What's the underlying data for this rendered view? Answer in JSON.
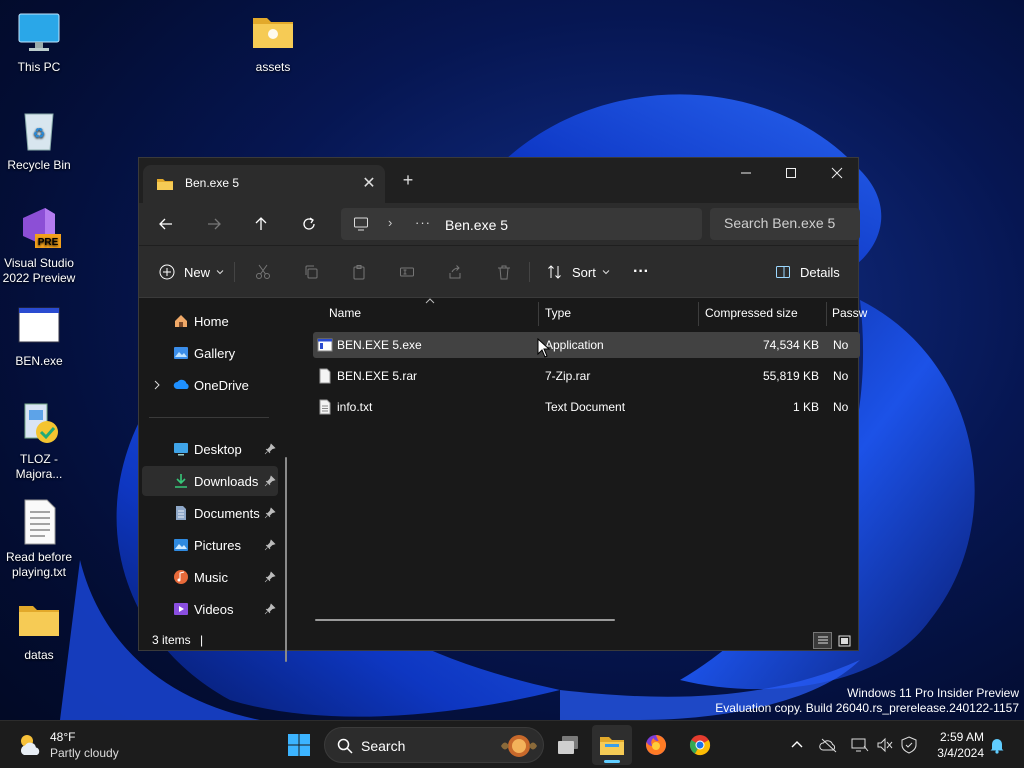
{
  "desktop": {
    "icons": [
      {
        "label": "This PC",
        "icon": "monitor-icon"
      },
      {
        "label": "assets",
        "icon": "folder-icon"
      },
      {
        "label": "Recycle Bin",
        "icon": "recycle-bin-icon"
      },
      {
        "label": "Visual Studio\n2022 Preview",
        "icon": "visual-studio-icon",
        "badge": "PRE"
      },
      {
        "label": "BEN.exe",
        "icon": "exe-window-icon"
      },
      {
        "label": "TLOZ -\nMajora...",
        "icon": "installer-icon"
      },
      {
        "label": "Read before\nplaying.txt",
        "icon": "text-file-icon"
      },
      {
        "label": "datas",
        "icon": "folder-icon"
      }
    ],
    "watermark": {
      "line1": "Windows 11 Pro Insider Preview",
      "line2": "Evaluation copy. Build 26040.rs_prerelease.240122-1157"
    }
  },
  "explorer": {
    "tab_title": "Ben.exe 5",
    "tab_close": "✕",
    "new_tab": "+",
    "window_controls": {
      "minimize": "minimize-icon",
      "maximize": "maximize-icon",
      "close": "close-icon"
    },
    "address": {
      "more": "···",
      "separator": "›",
      "crumb": "Ben.exe 5"
    },
    "search_placeholder": "Search Ben.exe 5",
    "toolbar": {
      "new_label": "New",
      "sort_label": "Sort",
      "more_label": "···",
      "details_label": "Details"
    },
    "sidebar": {
      "items": [
        {
          "label": "Home",
          "icon": "home-icon",
          "pinned": false
        },
        {
          "label": "Gallery",
          "icon": "gallery-icon",
          "pinned": false
        },
        {
          "label": "OneDrive",
          "icon": "onedrive-icon",
          "pinned": false,
          "expandable": true
        },
        {
          "label": "Desktop",
          "icon": "desktop-icon",
          "pinned": true
        },
        {
          "label": "Downloads",
          "icon": "downloads-icon",
          "pinned": true,
          "selected": true
        },
        {
          "label": "Documents",
          "icon": "documents-icon",
          "pinned": true
        },
        {
          "label": "Pictures",
          "icon": "pictures-icon",
          "pinned": true
        },
        {
          "label": "Music",
          "icon": "music-icon",
          "pinned": true
        },
        {
          "label": "Videos",
          "icon": "videos-icon",
          "pinned": true
        }
      ]
    },
    "columns": [
      "Name",
      "Type",
      "Compressed size",
      "Passw"
    ],
    "files": [
      {
        "name": "BEN.EXE 5.exe",
        "type": "Application",
        "size": "74,534 KB",
        "password": "No",
        "icon": "application-file-icon",
        "selected": true
      },
      {
        "name": "BEN.EXE 5.rar",
        "type": "7-Zip.rar",
        "size": "55,819 KB",
        "password": "No",
        "icon": "archive-file-icon"
      },
      {
        "name": "info.txt",
        "type": "Text Document",
        "size": "1 KB",
        "password": "No",
        "icon": "text-file-icon"
      }
    ],
    "status": {
      "item_count": "3 items",
      "divider": "|"
    }
  },
  "taskbar": {
    "weather": {
      "temp": "48°F",
      "desc": "Partly cloudy"
    },
    "search_label": "Search",
    "apps": [
      "windows-start-icon",
      "task-view-icon",
      "file-explorer-icon",
      "firefox-icon",
      "chrome-icon"
    ],
    "clock": {
      "time": "2:59 AM",
      "date": "3/4/2024"
    }
  },
  "colors": {
    "accent": "#60cdff",
    "folder": "#f3c34a",
    "window_bg": "#191919",
    "toolbar_bg": "#2c2c2c"
  }
}
